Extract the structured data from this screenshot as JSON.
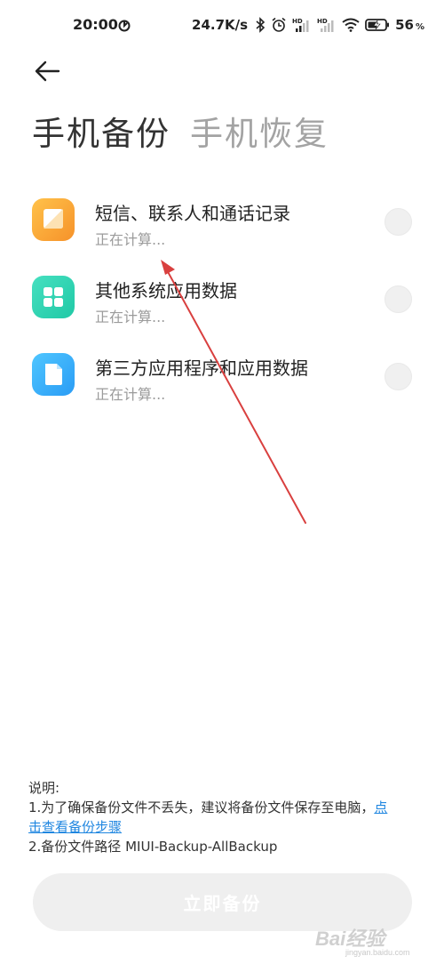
{
  "status_bar": {
    "time": "20:00",
    "net_speed": "24.7K/s",
    "battery_level": "56",
    "battery_unit": "%",
    "icons": [
      "timer-icon",
      "bluetooth-icon",
      "alarm-icon",
      "hd-signal-icon",
      "hd-signal-icon",
      "wifi-icon",
      "battery-charging-icon"
    ]
  },
  "header": {
    "back_icon": "arrow-left-icon",
    "tabs": [
      {
        "label": "手机备份",
        "active": true
      },
      {
        "label": "手机恢复",
        "active": false
      }
    ]
  },
  "items": [
    {
      "title": "短信、联系人和通话记录",
      "status": "正在计算...",
      "icon": "sms-icon",
      "color": "#f7a233",
      "checked": false
    },
    {
      "title": "其他系统应用数据",
      "status": "正在计算...",
      "icon": "apps-grid-icon",
      "color": "#2dd4b0",
      "checked": false
    },
    {
      "title": "第三方应用程序和应用数据",
      "status": "正在计算...",
      "icon": "document-icon",
      "color": "#38aefb",
      "checked": false
    }
  ],
  "notes": {
    "heading": "说明:",
    "line1_prefix": "1.为了确保备份文件不丢失，建议将备份文件保存至电脑，",
    "line1_link_a": "点",
    "line1_link_b": "击查看备份步骤",
    "line2": "2.备份文件路径 MIUI-Backup-AllBackup"
  },
  "backup_button": {
    "label": "立即备份"
  },
  "colors": {
    "accent": "#1f86e0",
    "annotation_arrow": "#d9403f",
    "button_disabled": "#efefef"
  },
  "watermark": {
    "text": "Bai经验",
    "sub": "jingyan.baidu.com"
  }
}
